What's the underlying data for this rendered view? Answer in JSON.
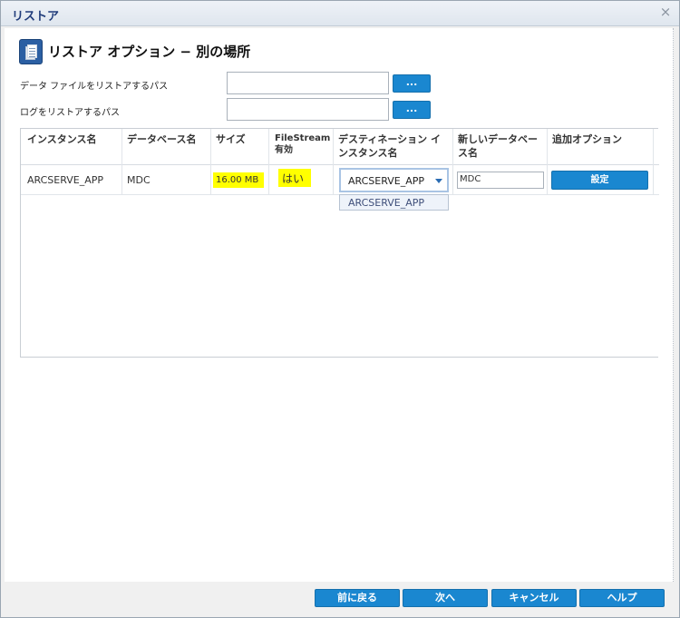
{
  "window": {
    "title": "リストア",
    "close_glyph": "×"
  },
  "header": {
    "title": "リストア オプション − 別の場所",
    "icon": "document-stack-icon"
  },
  "paths": {
    "data_file_label": "データ ファイルをリストアするパス",
    "data_file_value": "",
    "log_label": "ログをリストアするパス",
    "log_value": "",
    "browse_label": "..."
  },
  "grid": {
    "columns": {
      "instance": "インスタンス名",
      "database": "データベース名",
      "size": "サイズ",
      "filestream_1": "FileStream",
      "filestream_2": "有効",
      "dest_instance_1": "デスティネーション イ",
      "dest_instance_2": "ンスタンス名",
      "new_db_1": "新しいデータベー",
      "new_db_2": "ス名",
      "extra": "追加オプション"
    },
    "rows": [
      {
        "instance": "ARCSERVE_APP",
        "database": "MDC",
        "size": "16.00 MB",
        "filestream": "はい",
        "dest_instance": "ARCSERVE_APP",
        "new_db": "MDC",
        "settings_label": "設定"
      }
    ],
    "dest_options": [
      "ARCSERVE_APP"
    ]
  },
  "footer": {
    "back": "前に戻る",
    "next": "次へ",
    "cancel": "キャンセル",
    "help": "ヘルプ"
  },
  "colors": {
    "accent": "#1a87d0",
    "highlight": "#ffff00",
    "title": "#1f3b7a"
  }
}
